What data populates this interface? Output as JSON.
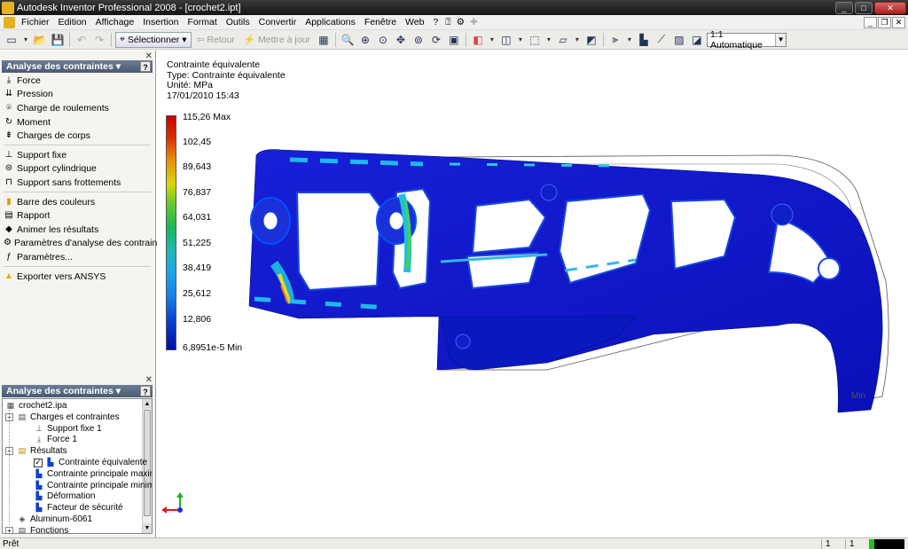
{
  "window": {
    "title": "Autodesk Inventor Professional 2008 - [crochet2.ipt]"
  },
  "menu": [
    "Fichier",
    "Edition",
    "Affichage",
    "Insertion",
    "Format",
    "Outils",
    "Convertir",
    "Applications",
    "Fenêtre",
    "Web",
    "?"
  ],
  "toolbar": {
    "select_label": "Sélectionner",
    "back_label": "Retour",
    "update_label": "Mettre à jour",
    "scale_value": "1:1 Automatique"
  },
  "panel": {
    "title": "Analyse des contraintes",
    "groups": [
      [
        {
          "label": "Force",
          "icon": "force-icon"
        },
        {
          "label": "Pression",
          "icon": "pressure-icon"
        },
        {
          "label": "Charge de roulements",
          "icon": "bearing-load-icon"
        },
        {
          "label": "Moment",
          "icon": "moment-icon"
        },
        {
          "label": "Charges de corps",
          "icon": "body-load-icon"
        }
      ],
      [
        {
          "label": "Support fixe",
          "icon": "fixed-support-icon"
        },
        {
          "label": "Support cylindrique",
          "icon": "cylindrical-support-icon"
        },
        {
          "label": "Support sans frottements",
          "icon": "frictionless-support-icon"
        }
      ],
      [
        {
          "label": "Barre des couleurs",
          "icon": "color-bar-icon"
        },
        {
          "label": "Rapport",
          "icon": "report-icon"
        },
        {
          "label": "Animer les résultats",
          "icon": "animate-icon"
        },
        {
          "label": "Paramètres d'analyse des contraintes",
          "icon": "analysis-settings-icon"
        },
        {
          "label": "Paramètres...",
          "icon": "parameters-icon"
        }
      ],
      [
        {
          "label": "Exporter vers ANSYS",
          "icon": "ansys-export-icon"
        }
      ]
    ]
  },
  "browser": {
    "title": "Analyse des contraintes",
    "nodes": [
      {
        "label": "crochet2.ipa",
        "level": 0
      },
      {
        "label": "Charges et contraintes",
        "level": 1
      },
      {
        "label": "Support fixe 1",
        "level": 2
      },
      {
        "label": "Force 1",
        "level": 2
      },
      {
        "label": "Résultats",
        "level": 1
      },
      {
        "label": "Contrainte équivalente",
        "level": 2,
        "checked": true
      },
      {
        "label": "Contrainte principale maximale",
        "level": 2
      },
      {
        "label": "Contrainte principale minimale",
        "level": 2
      },
      {
        "label": "Déformation",
        "level": 2
      },
      {
        "label": "Facteur de sécurité",
        "level": 2
      },
      {
        "label": "Aluminum-6061",
        "level": 1
      },
      {
        "label": "Fonctions",
        "level": 1
      }
    ]
  },
  "result": {
    "title": "Contrainte équivalente",
    "type": "Type: Contrainte équivalente",
    "unit": "Unité: MPa",
    "date": "17/01/2010 15:43",
    "legend_ticks": [
      "115,26 Max",
      "102,45",
      "89,643",
      "76,837",
      "64,031",
      "51,225",
      "38,419",
      "25,612",
      "12,806",
      "6,8951e-5 Min"
    ],
    "min_marker": "Min"
  },
  "status": {
    "text": "Prêt",
    "field1": "1",
    "field2": "1"
  }
}
